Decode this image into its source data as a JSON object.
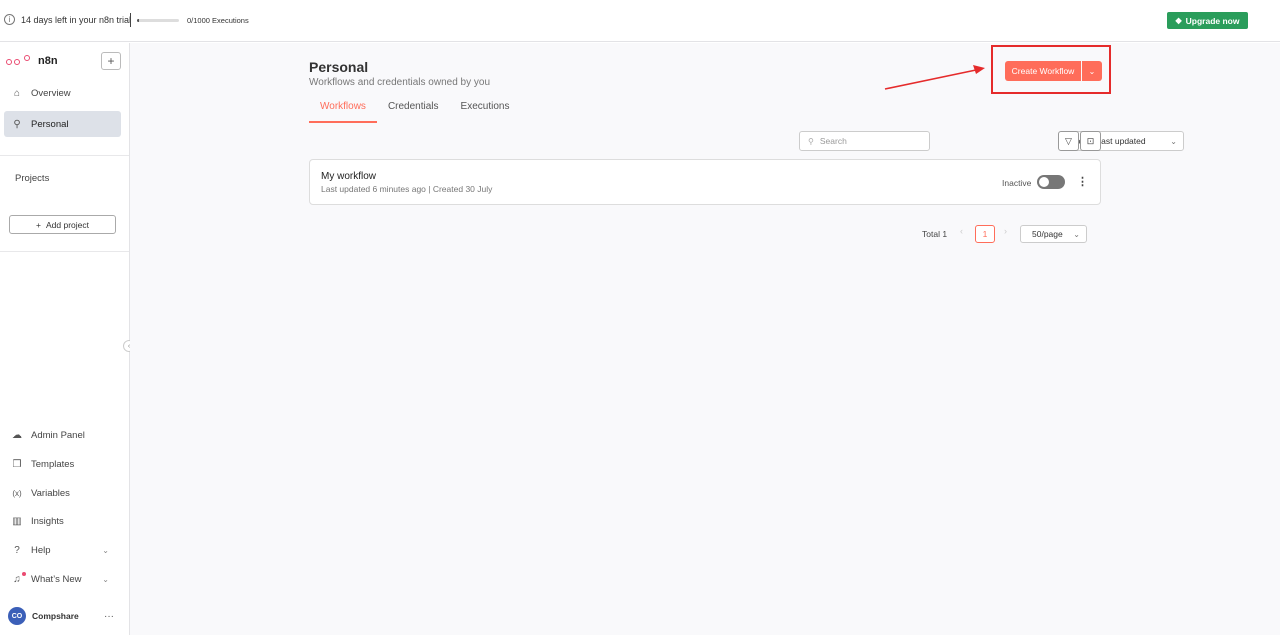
{
  "banner": {
    "trial_text": "14 days left in your n8n trial",
    "executions_text": "0/1000 Executions",
    "executions_progress": 0.05,
    "upgrade_label": "Upgrade now",
    "upgrade_color": "#2a9d5b"
  },
  "sidebar": {
    "logo_name": "n8n",
    "nav": [
      {
        "label": "Overview",
        "icon": "home-icon"
      },
      {
        "label": "Personal",
        "icon": "user-icon",
        "active": true
      }
    ],
    "projects_label": "Projects",
    "add_project_label": "Add project",
    "bottom": [
      {
        "label": "Admin Panel",
        "icon": "cloud-icon"
      },
      {
        "label": "Templates",
        "icon": "box-icon"
      },
      {
        "label": "Variables",
        "icon": "variable-icon"
      },
      {
        "label": "Insights",
        "icon": "chart-icon"
      },
      {
        "label": "Help",
        "icon": "help-icon"
      },
      {
        "label": "What’s New",
        "icon": "bell-icon"
      }
    ],
    "user": {
      "initials": "CO",
      "name": "Compshare"
    }
  },
  "main": {
    "title": "Personal",
    "subtitle": "Workflows and credentials owned by you",
    "create_label": "Create Workflow",
    "tabs": [
      {
        "label": "Workflows",
        "active": true
      },
      {
        "label": "Credentials"
      },
      {
        "label": "Executions"
      }
    ],
    "search_placeholder": "Search",
    "sort_label": "Sort by last updated",
    "workflows": [
      {
        "name": "My workflow",
        "meta": "Last updated 6 minutes ago | Created 30 July",
        "status": "Inactive"
      }
    ],
    "pagination": {
      "total": "Total 1",
      "page": "1",
      "per_page": "50/page"
    },
    "accent_color": "#ff6d5a"
  }
}
